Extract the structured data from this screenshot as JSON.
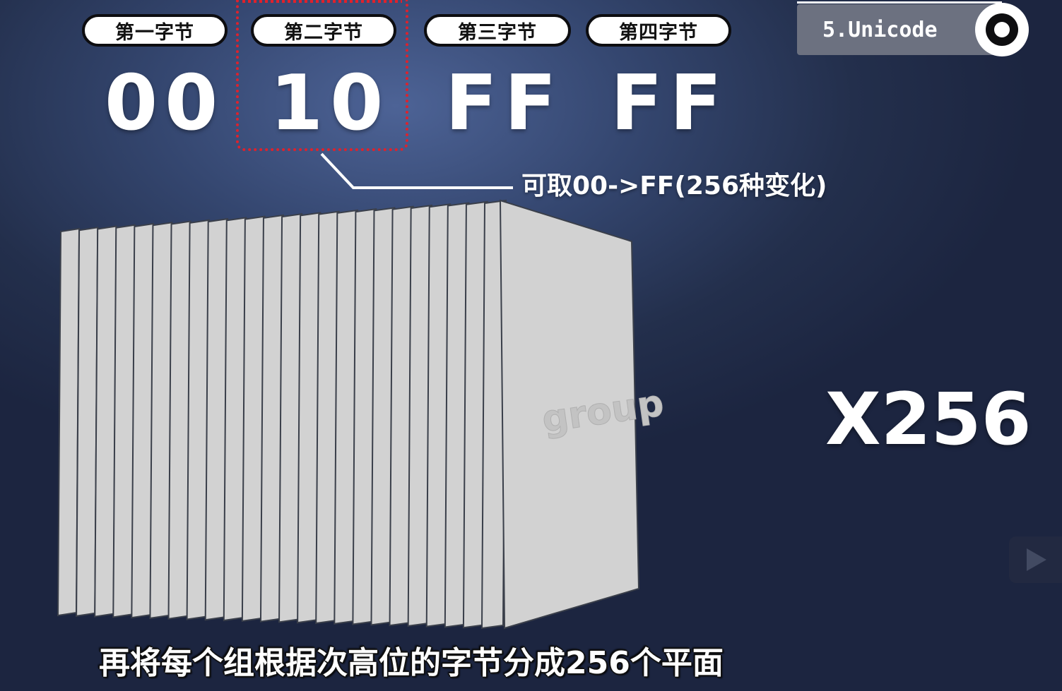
{
  "byte_labels": [
    "第一字节",
    "第二字节",
    "第三字节",
    "第四字节"
  ],
  "byte_values": [
    "00",
    "10",
    "FF",
    "FF"
  ],
  "highlighted_byte_index": 1,
  "range_note": "可取00->FF(256种变化)",
  "plane_label": "group",
  "multiplier": "X256",
  "section_badge": "5.Unicode",
  "subtitle": "再将每个组根据次高位的字节分成256个平面",
  "colors": {
    "highlight": "#e0212b",
    "plane_fill": "#d2d2d2",
    "plane_edge": "#3a3f4a"
  }
}
